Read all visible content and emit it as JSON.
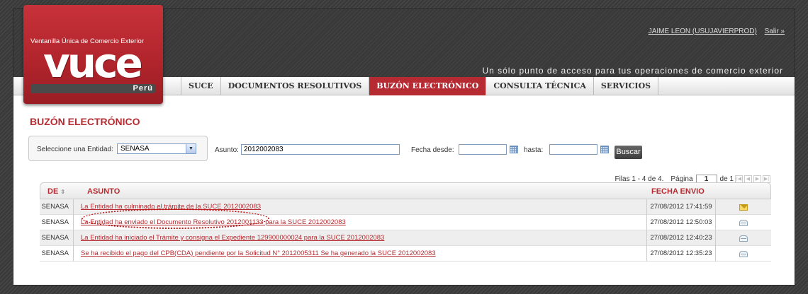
{
  "logo": {
    "top_text": "Ventanilla Única de Comercio Exterior",
    "brand": "vuce",
    "country": "Perú"
  },
  "header": {
    "user": "JAIME LEON (USUJAVIERPROD)",
    "logout": "Salir »",
    "tagline": "Un sólo punto de acceso para tus operaciones de comercio exterior"
  },
  "nav": {
    "tabs": [
      {
        "label": "SUCE",
        "active": false
      },
      {
        "label": "DOCUMENTOS RESOLUTIVOS",
        "active": false
      },
      {
        "label": "BUZÓN ELECTRÓNICO",
        "active": true
      },
      {
        "label": "CONSULTA TÉCNICA",
        "active": false
      },
      {
        "label": "SERVICIOS",
        "active": false
      }
    ]
  },
  "page_title": "BUZÓN ELECTRÓNICO",
  "filters": {
    "entity_label": "Seleccione una Entidad:",
    "entity_value": "SENASA",
    "asunto_label": "Asunto:",
    "asunto_value": "2012002083",
    "fecha_desde_label": "Fecha desde:",
    "fecha_desde_value": "",
    "hasta_label": "hasta:",
    "hasta_value": "",
    "search_button": "Buscar"
  },
  "pager": {
    "rows_info": "Filas 1 - 4 de 4.",
    "page_label": "Página",
    "page_value": "1",
    "of_label": "de 1"
  },
  "table": {
    "headers": {
      "de": "DE",
      "asunto": "ASUNTO",
      "fecha": "FECHA ENVIO"
    },
    "rows": [
      {
        "de": "SENASA",
        "asunto": "La Entidad ha culminado el trámite de la SUCE 2012002083",
        "fecha": "27/08/2012 17:41:59",
        "status": "unread"
      },
      {
        "de": "SENASA",
        "asunto": "La Entidad ha enviado el Documento Resolutivo 2012001133 para la SUCE 2012002083",
        "fecha": "27/08/2012 12:50:03",
        "status": "read"
      },
      {
        "de": "SENASA",
        "asunto": "La Entidad ha iniciado el Trámite y consigna el Expediente 129900000024 para la SUCE 2012002083",
        "fecha": "27/08/2012 12:40:23",
        "status": "read"
      },
      {
        "de": "SENASA",
        "asunto": "Se ha recibido el pago del CPB(CDA) pendiente por la Solicitud N° 2012005311 Se ha generado la SUCE 2012002083",
        "fecha": "27/08/2012 12:35:23",
        "status": "read"
      }
    ]
  }
}
